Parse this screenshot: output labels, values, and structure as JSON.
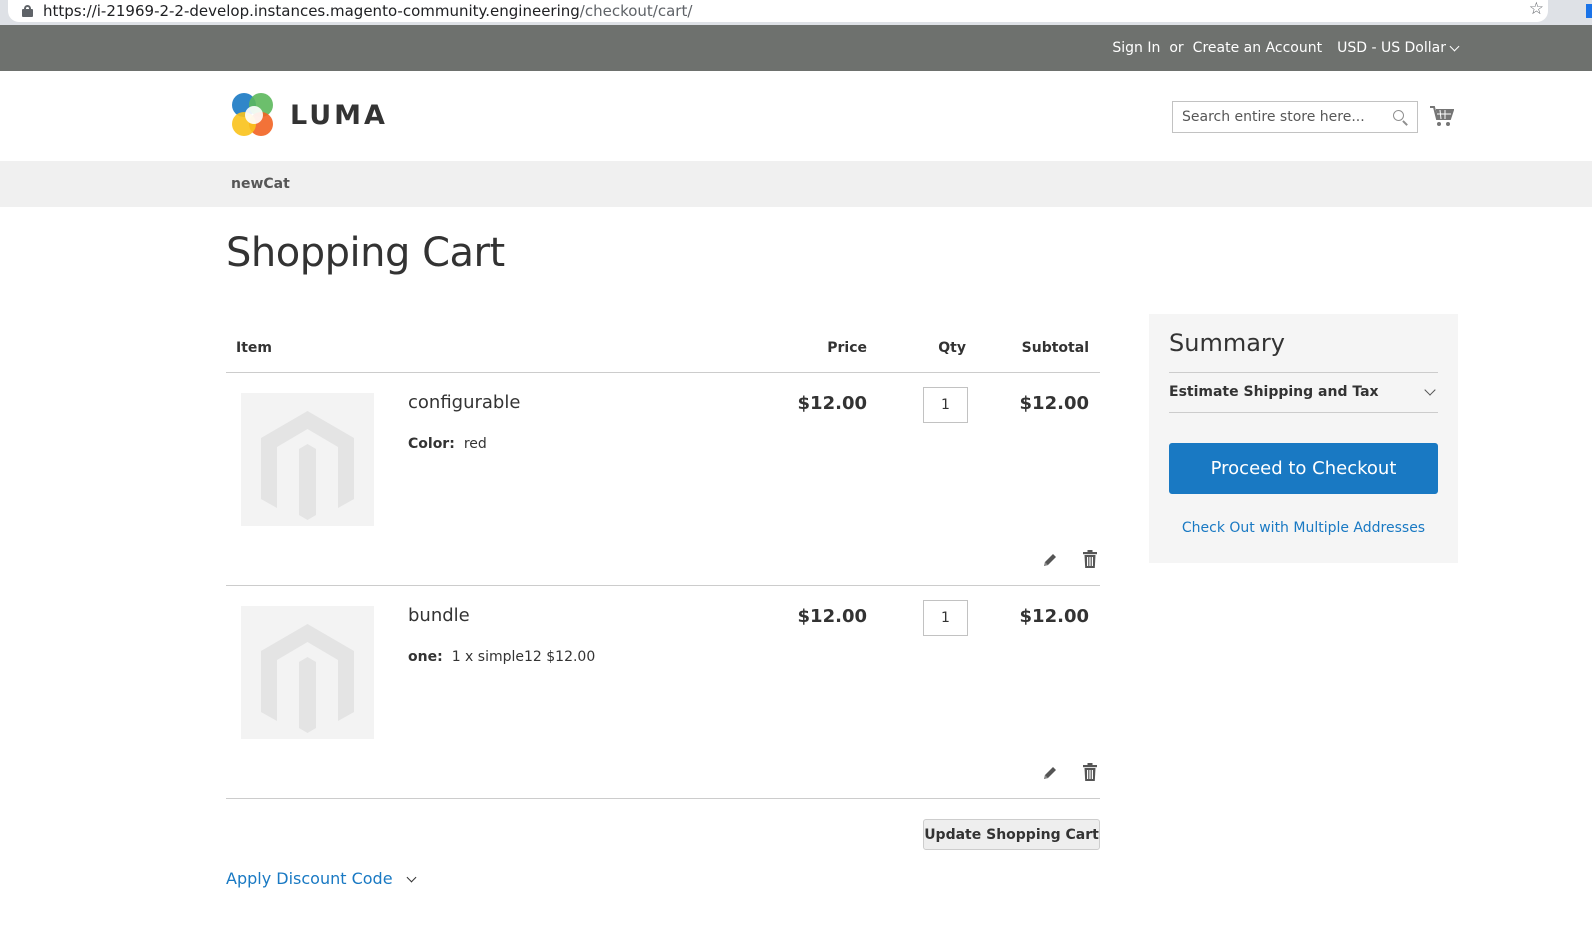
{
  "browser": {
    "url_host": "https://i-21969-2-2-develop.instances.magento-community.engineering",
    "url_path": "/checkout/cart/"
  },
  "header": {
    "sign_in": "Sign In",
    "or": "or",
    "create_account": "Create an Account",
    "currency": "USD - US Dollar"
  },
  "logo": {
    "text": "LUMA"
  },
  "search": {
    "placeholder": "Search entire store here..."
  },
  "nav": {
    "items": [
      "newCat"
    ]
  },
  "page": {
    "title": "Shopping Cart"
  },
  "cart": {
    "columns": {
      "item": "Item",
      "price": "Price",
      "qty": "Qty",
      "subtotal": "Subtotal"
    },
    "items": [
      {
        "name": "configurable",
        "option_label": "Color:",
        "option_value": "red",
        "price": "$12.00",
        "qty": "1",
        "subtotal": "$12.00"
      },
      {
        "name": "bundle",
        "option_label": "one:",
        "option_value": "1 x simple12 $12.00",
        "price": "$12.00",
        "qty": "1",
        "subtotal": "$12.00"
      }
    ],
    "update_label": "Update Shopping Cart",
    "discount_label": "Apply Discount Code"
  },
  "summary": {
    "title": "Summary",
    "estimate_label": "Estimate Shipping and Tax",
    "checkout_label": "Proceed to Checkout",
    "multi_label": "Check Out with Multiple Addresses"
  },
  "colors": {
    "accent": "#1979c3",
    "header_bg": "#6e716e",
    "nav_bg": "#f0f0f0",
    "summary_bg": "#f5f5f5"
  }
}
